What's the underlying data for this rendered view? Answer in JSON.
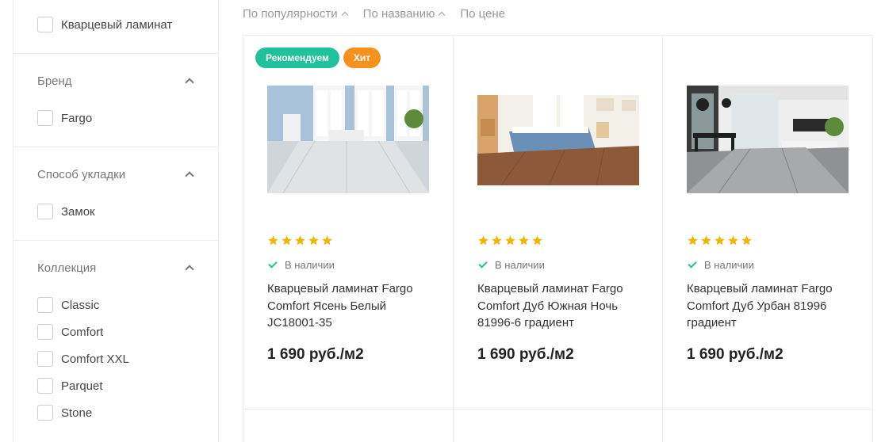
{
  "sidebar": {
    "top_option": "Кварцевый ламинат",
    "groups": [
      {
        "title": "Бренд",
        "options": [
          "Fargo"
        ]
      },
      {
        "title": "Способ укладки",
        "options": [
          "Замок"
        ]
      },
      {
        "title": "Коллекция",
        "options": [
          "Classic",
          "Comfort",
          "Comfort XXL",
          "Parquet",
          "Stone"
        ]
      }
    ]
  },
  "sort": {
    "popularity": "По популярности",
    "name": "По названию",
    "price": "По цене"
  },
  "badges": {
    "recommend": "Рекомендуем",
    "hit": "Хит"
  },
  "colors": {
    "accent_green": "#1fc29a",
    "accent_orange": "#f5921d",
    "star": "#f5b301"
  },
  "products": [
    {
      "rating": 5,
      "stock": "В наличии",
      "name": "Кварцевый ламинат Fargo Comfort Ясень Белый JC18001-35",
      "price": "1 690 руб./м2"
    },
    {
      "rating": 5,
      "stock": "В наличии",
      "name": "Кварцевый ламинат Fargo Comfort Дуб Южная Ночь 81996-6 градиент",
      "price": "1 690 руб./м2"
    },
    {
      "rating": 5,
      "stock": "В наличии",
      "name": "Кварцевый ламинат Fargo Comfort Дуб Урбан 81996 градиент",
      "price": "1 690 руб./м2"
    }
  ]
}
